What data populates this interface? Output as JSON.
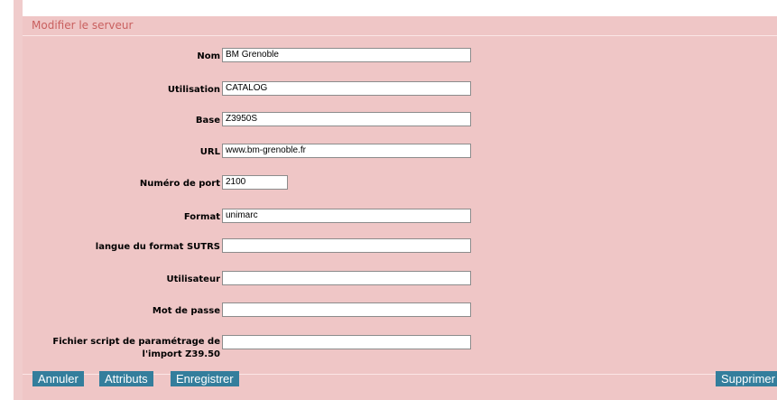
{
  "form": {
    "title": "Modifier le serveur",
    "fields": [
      {
        "label": "Nom",
        "value": "BM Grenoble"
      },
      {
        "label": "Utilisation",
        "value": "CATALOG"
      },
      {
        "label": "Base",
        "value": "Z3950S"
      },
      {
        "label": "URL",
        "value": "www.bm-grenoble.fr"
      },
      {
        "label": "Numéro de port",
        "value": "2100"
      },
      {
        "label": "Format",
        "value": "unimarc"
      },
      {
        "label": "langue du format SUTRS",
        "value": ""
      },
      {
        "label": "Utilisateur",
        "value": ""
      },
      {
        "label": "Mot de passe",
        "value": ""
      },
      {
        "label": "Fichier script de paramétrage de l'import Z39.50",
        "value": ""
      }
    ]
  },
  "actions": {
    "cancel": "Annuler",
    "attributes": "Attributs",
    "save": "Enregistrer",
    "delete": "Supprimer"
  }
}
